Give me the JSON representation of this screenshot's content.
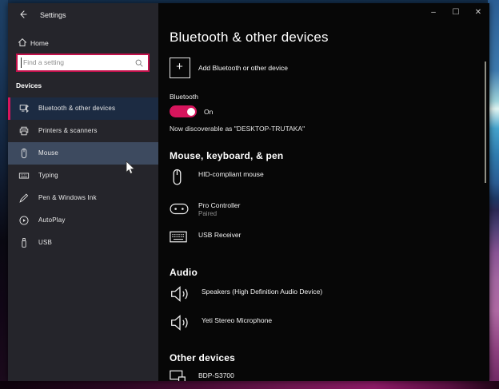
{
  "colors": {
    "accent": "#d6155c",
    "sidebar_bg": "#25252b",
    "main_bg": "#070707",
    "selected_row_bg": "#1c2b42",
    "hover_row_bg": "#3d4a5f",
    "search_border": "#c3114b"
  },
  "titlebar": {
    "back_icon": "back-arrow-icon",
    "title": "Settings",
    "minimize": "–",
    "maximize": "☐",
    "close": "✕"
  },
  "sidebar": {
    "home_label": "Home",
    "home_icon": "home-icon",
    "search": {
      "placeholder": "Find a setting",
      "icon": "search-icon"
    },
    "section_label": "Devices",
    "items": [
      {
        "label": "Bluetooth & other devices",
        "icon": "bluetooth-devices-icon",
        "selected": true
      },
      {
        "label": "Printers & scanners",
        "icon": "printer-icon",
        "selected": false
      },
      {
        "label": "Mouse",
        "icon": "mouse-icon",
        "selected": false,
        "hovered": true
      },
      {
        "label": "Typing",
        "icon": "keyboard-icon",
        "selected": false
      },
      {
        "label": "Pen & Windows Ink",
        "icon": "pen-icon",
        "selected": false
      },
      {
        "label": "AutoPlay",
        "icon": "autoplay-icon",
        "selected": false
      },
      {
        "label": "USB",
        "icon": "usb-icon",
        "selected": false
      }
    ]
  },
  "main": {
    "title": "Bluetooth & other devices",
    "add_button": {
      "label": "Add Bluetooth or other device",
      "icon": "plus-icon"
    },
    "bluetooth": {
      "label": "Bluetooth",
      "state": "On",
      "toggle_on": true,
      "discoverable_text": "Now discoverable as \"DESKTOP-TRUTAKA\""
    },
    "sections": [
      {
        "title": "Mouse, keyboard, & pen",
        "devices": [
          {
            "name": "HID-compliant mouse",
            "status": "",
            "icon": "mouse-icon"
          },
          {
            "name": "Pro Controller",
            "status": "Paired",
            "icon": "gamepad-icon"
          },
          {
            "name": "USB Receiver",
            "status": "",
            "icon": "keyboard-icon"
          }
        ]
      },
      {
        "title": "Audio",
        "devices": [
          {
            "name": "Speakers (High Definition Audio Device)",
            "status": "",
            "icon": "speaker-icon"
          },
          {
            "name": "Yeti Stereo Microphone",
            "status": "",
            "icon": "speaker-icon"
          }
        ]
      },
      {
        "title": "Other devices",
        "devices": [
          {
            "name": "BDP-S3700",
            "status": "",
            "icon": "media-player-icon"
          }
        ]
      }
    ]
  }
}
